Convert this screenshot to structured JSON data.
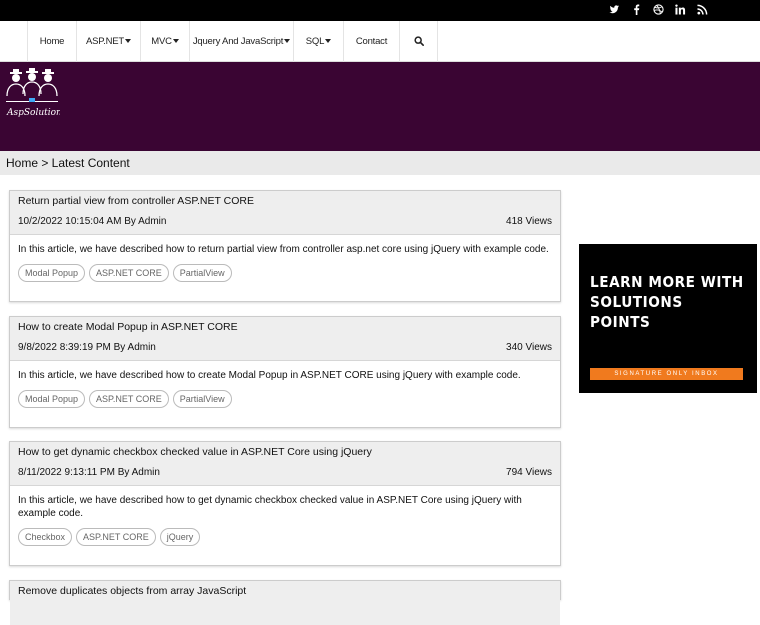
{
  "social": [
    "twitter-icon",
    "facebook-icon",
    "dribbble-icon",
    "linkedin-icon",
    "rss-icon"
  ],
  "nav": [
    {
      "label": "Home",
      "dropdown": false
    },
    {
      "label": "ASP.NET",
      "dropdown": true
    },
    {
      "label": "MVC",
      "dropdown": true
    },
    {
      "label": "Jquery And JavaScript",
      "dropdown": true
    },
    {
      "label": "SQL",
      "dropdown": true
    },
    {
      "label": "Contact",
      "dropdown": false
    }
  ],
  "breadcrumb": "Home > Latest Content",
  "posts": [
    {
      "title": "Return partial view from controller ASP.NET CORE",
      "date": "10/2/2022 10:15:04 AM By Admin",
      "views": "418 Views",
      "summary": "In this article, we have described how to return partial view from controller asp.net core using jQuery with example code.",
      "tags": [
        "Modal Popup",
        "ASP.NET CORE",
        "PartialView"
      ]
    },
    {
      "title": "How to create Modal Popup in ASP.NET CORE",
      "date": "9/8/2022 8:39:19 PM By Admin",
      "views": "340 Views",
      "summary": "In this article, we have described how to create Modal Popup in ASP.NET CORE using jQuery with example code.",
      "tags": [
        "Modal Popup",
        "ASP.NET CORE",
        "PartialView"
      ]
    },
    {
      "title": "How to get dynamic checkbox checked value in ASP.NET Core using jQuery",
      "date": "8/11/2022 9:13:11 PM By Admin",
      "views": "794 Views",
      "summary": "In this article, we have described how to get dynamic checkbox checked value in ASP.NET Core using jQuery with example code.",
      "tags": [
        "Checkbox",
        "ASP.NET CORE",
        "jQuery"
      ]
    },
    {
      "title": "Remove duplicates objects from array JavaScript"
    }
  ],
  "ad": {
    "title": "LEARN MORE WITH SOLUTIONS POINTS",
    "subtitle": "SIGNATURE ONLY INBOX"
  },
  "colors": {
    "banner": "#3a0533",
    "topbar": "#000000",
    "ad_accent": "#f07a1e"
  }
}
